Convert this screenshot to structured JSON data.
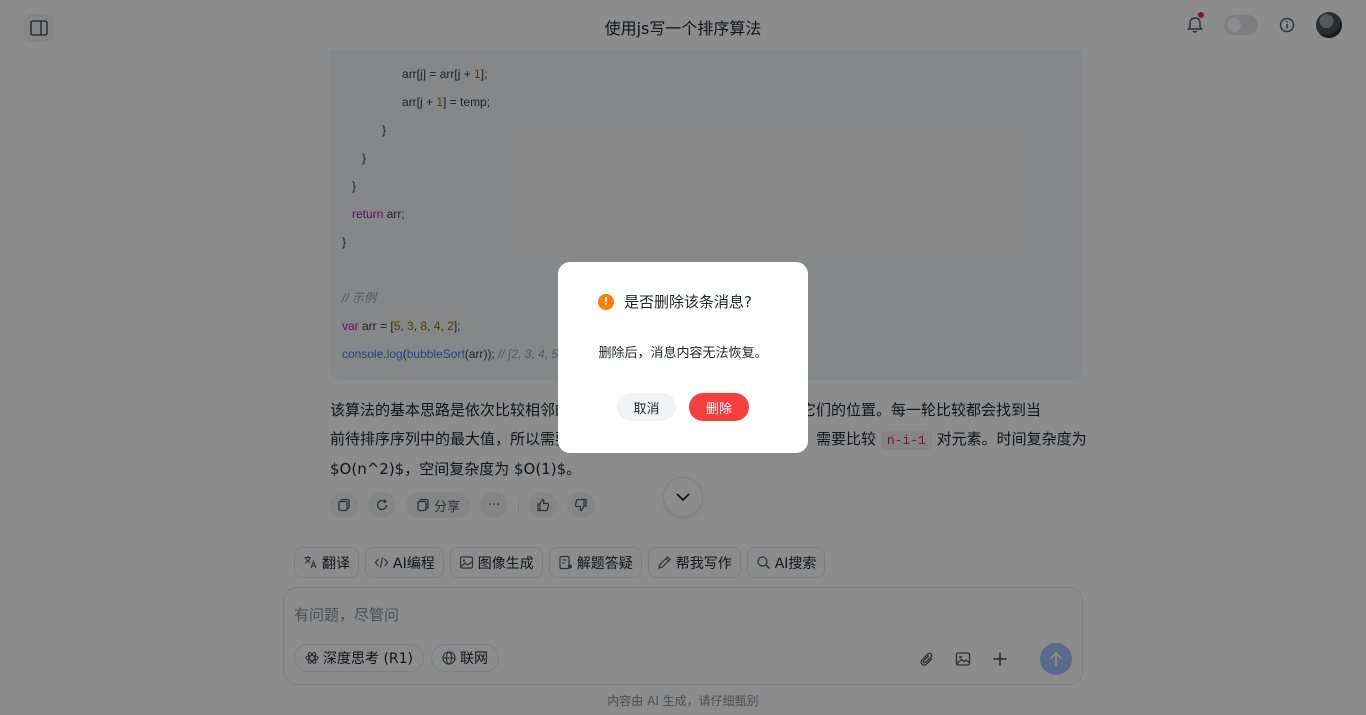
{
  "header": {
    "title": "使用js写一个排序算法"
  },
  "code": {
    "lines": [
      {
        "indent": "      ",
        "parts": [
          [
            "plain",
            "arr[j] = arr[j + "
          ],
          [
            "num",
            "1"
          ],
          [
            "plain",
            "];"
          ]
        ]
      },
      {
        "indent": "      ",
        "parts": [
          [
            "plain",
            "arr[j + "
          ],
          [
            "num",
            "1"
          ],
          [
            "plain",
            "] = temp;"
          ]
        ]
      },
      {
        "indent": "    ",
        "parts": [
          [
            "plain",
            "}"
          ]
        ]
      },
      {
        "indent": "  ",
        "parts": [
          [
            "plain",
            "}"
          ]
        ]
      },
      {
        "indent": " ",
        "parts": [
          [
            "plain",
            "}"
          ]
        ]
      },
      {
        "indent": " ",
        "parts": [
          [
            "kw",
            "return"
          ],
          [
            "plain",
            " arr;"
          ]
        ]
      },
      {
        "indent": "",
        "parts": [
          [
            "plain",
            "}"
          ]
        ]
      },
      {
        "indent": "",
        "parts": []
      },
      {
        "indent": "",
        "parts": [
          [
            "cm",
            "// 示例"
          ]
        ]
      },
      {
        "indent": "",
        "parts": [
          [
            "kw",
            "var"
          ],
          [
            "plain",
            " arr = ["
          ],
          [
            "num",
            "5"
          ],
          [
            "plain",
            ", "
          ],
          [
            "num",
            "3"
          ],
          [
            "plain",
            ", "
          ],
          [
            "num",
            "8"
          ],
          [
            "plain",
            ", "
          ],
          [
            "num",
            "4"
          ],
          [
            "plain",
            ", "
          ],
          [
            "num",
            "2"
          ],
          [
            "plain",
            "];"
          ]
        ]
      },
      {
        "indent": "",
        "parts": [
          [
            "fn",
            "console"
          ],
          [
            "plain",
            "."
          ],
          [
            "fn",
            "log"
          ],
          [
            "plain",
            "("
          ],
          [
            "fn",
            "bubbleSort"
          ],
          [
            "plain",
            "(arr)); "
          ],
          [
            "cm",
            "// [2, 3, 4, 5"
          ]
        ]
      }
    ]
  },
  "answer": {
    "line1": "该算法的基本思路是依次比较相邻的",
    "line1_tail": "则交换它们的位置。每一轮比较都会找到当",
    "line2": "前待排序序列中的最大值，所以需要",
    "line2_mid": "需要比较",
    "inline_code": "n-i-1",
    "line2_tail": "对元素。时间复杂度为",
    "line3": "$O(n^2)$，空间复杂度为 $O(1)$。"
  },
  "actions": {
    "share_label": "分享",
    "more_label": "···"
  },
  "skills": [
    {
      "icon": "translate-icon",
      "label": "翻译"
    },
    {
      "icon": "code-icon",
      "label": "AI编程"
    },
    {
      "icon": "image-icon",
      "label": "图像生成"
    },
    {
      "icon": "question-icon",
      "label": "解题答疑"
    },
    {
      "icon": "pen-icon",
      "label": "帮我写作"
    },
    {
      "icon": "search-icon",
      "label": "AI搜索"
    }
  ],
  "input": {
    "placeholder": "有问题，尽管问",
    "deep_think_label": "深度思考 (R1)",
    "web_label": "联网"
  },
  "footer": {
    "note": "内容由 AI 生成，请仔细甄别"
  },
  "dialog": {
    "title": "是否删除该条消息?",
    "body": "删除后，消息内容无法恢复。",
    "cancel_label": "取消",
    "delete_label": "删除"
  },
  "colors": {
    "danger": "#f53f3f",
    "warning": "#ff7d00",
    "send": "#a3c1fc"
  }
}
